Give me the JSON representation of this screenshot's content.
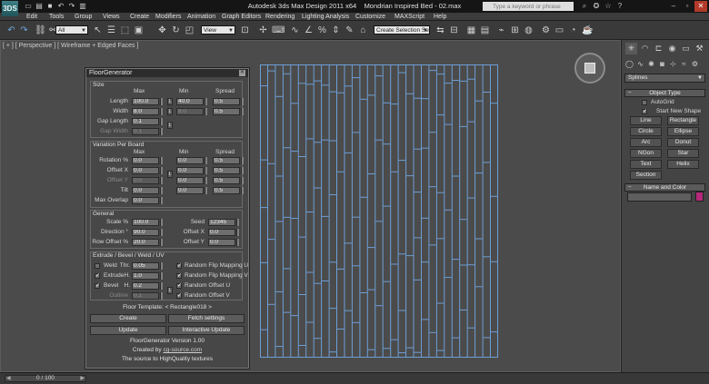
{
  "app": {
    "title": "Autodesk 3ds Max Design 2011 x64",
    "file": "Mondrian Inspired Bed - 02.max",
    "logo": "3DS",
    "search_placeholder": "Type a keyword or phrase"
  },
  "menu": [
    "Edit",
    "Tools",
    "Group",
    "Views",
    "Create",
    "Modifiers",
    "Animation",
    "Graph Editors",
    "Rendering",
    "Lighting Analysis",
    "Customize",
    "MAXScript",
    "Help"
  ],
  "toolbar": {
    "filter_value": "All",
    "refcoord_value": "View",
    "selection_set_placeholder": "Create Selection Se"
  },
  "viewport": {
    "label": "[ + ] [ Perspective ] [ Wireframe + Edged Faces ]",
    "wire_color": "#6d9ed6",
    "background": "#4b4b4b"
  },
  "floor_generator": {
    "title": "FloorGenerator",
    "size": {
      "group_title": "Size",
      "headers": [
        "Max",
        "Min",
        "Spread"
      ],
      "length": {
        "label": "Length",
        "max": "100.0",
        "min": "40.0",
        "spread": "0.5"
      },
      "width": {
        "label": "Width",
        "max": "8.0",
        "min": "8.0",
        "spread": "0.5"
      },
      "gap_length": {
        "label": "Gap Length",
        "value": "0.1"
      },
      "gap_width": {
        "label": "Gap Width",
        "value": "0.1"
      },
      "lock": "L"
    },
    "variation": {
      "group_title": "Variation Per Board",
      "headers": [
        "Max",
        "Min",
        "Spread"
      ],
      "rotation": {
        "label": "Rotation %",
        "max": "0.0",
        "min": "0.0",
        "spread": "0.5"
      },
      "offset_x": {
        "label": "Offset X",
        "max": "0.0",
        "min": "0.0",
        "spread": "0.5"
      },
      "offset_y": {
        "label": "Offset Y",
        "max": "0.0",
        "min": "0.0",
        "spread": "0.5"
      },
      "tilt": {
        "label": "Tilt",
        "max": "0.0",
        "min": "0.0",
        "spread": "0.5"
      },
      "max_overlap": {
        "label": "Max Overlap",
        "value": "0.0"
      }
    },
    "general": {
      "group_title": "General",
      "scale": {
        "label": "Scale %",
        "value": "100.0"
      },
      "seed": {
        "label": "Seed",
        "value": "12345"
      },
      "direction": {
        "label": "Direction °",
        "value": "90.0"
      },
      "offset_x": {
        "label": "Offset X",
        "value": "0.0"
      },
      "row_offset": {
        "label": "Row Offset %",
        "value": "20.0"
      },
      "offset_y": {
        "label": "Offset Y",
        "value": "0.0"
      }
    },
    "extrude": {
      "group_title": "Extrude / Bevel / Weld / UV",
      "weld": {
        "label": "Weld",
        "thr_label": "Thr.",
        "value": "0.05",
        "checked": false
      },
      "extrude": {
        "label": "Extrude",
        "h_label": "H.",
        "value": "1.0",
        "checked": true
      },
      "bevel": {
        "label": "Bevel",
        "h_label": "H.",
        "value": "0.2",
        "checked": true
      },
      "outline": {
        "label": "Outline",
        "value": "0.1"
      },
      "random_flip_u": {
        "label": "Random Flip Mapping U",
        "checked": true
      },
      "random_flip_v": {
        "label": "Random Flip Mapping V",
        "checked": true
      },
      "random_offset_u": {
        "label": "Random Offset U",
        "checked": true
      },
      "random_offset_v": {
        "label": "Random Offset V",
        "checked": true
      }
    },
    "floor_template_label": "Floor Template:",
    "floor_template_value": "< Rectangle018 >",
    "buttons": {
      "create": "Create",
      "fetch_settings": "Fetch settings",
      "update": "Update",
      "interactive_update": "Interactive Update"
    },
    "version": "FloorGenerator Version 1.00",
    "created_by": "Created by",
    "created_by_link": "cg-source.com",
    "tagline": "The source to HighQuality textures"
  },
  "command_panel": {
    "category": "Splines",
    "object_type_title": "Object Type",
    "autogrid": {
      "label": "AutoGrid",
      "checked": false
    },
    "start_new_shape": {
      "label": "Start New Shape",
      "checked": true
    },
    "buttons": [
      "Line",
      "Rectangle",
      "Circle",
      "Ellipse",
      "Arc",
      "Donut",
      "NGon",
      "Star",
      "Text",
      "Helix",
      "Section"
    ],
    "name_color_title": "Name and Color",
    "swatch_color": "#b5287a"
  },
  "status": {
    "frame": "0 / 100"
  }
}
